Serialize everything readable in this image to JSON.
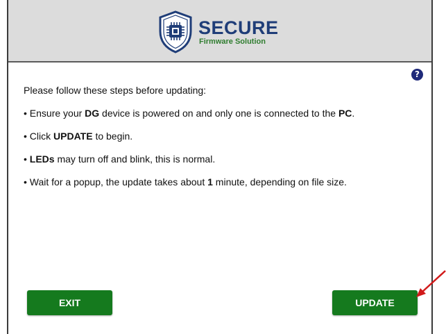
{
  "header": {
    "logo_title": "SECURE",
    "logo_subtitle": "Firmware Solution",
    "logo_icon": "chip-shield-icon"
  },
  "help": {
    "label": "?",
    "icon": "help-icon"
  },
  "instructions": {
    "intro": "Please follow these steps before updating:",
    "steps": [
      {
        "bullet": "•",
        "parts": [
          {
            "t": " Ensure your ",
            "b": false
          },
          {
            "t": "DG",
            "b": true
          },
          {
            "t": " device is powered on and only one is connected to the ",
            "b": false
          },
          {
            "t": "PC",
            "b": true
          },
          {
            "t": ".",
            "b": false
          }
        ]
      },
      {
        "bullet": "•",
        "parts": [
          {
            "t": " Click ",
            "b": false
          },
          {
            "t": "UPDATE",
            "b": true
          },
          {
            "t": " to begin.",
            "b": false
          }
        ]
      },
      {
        "bullet": "•",
        "parts": [
          {
            "t": " ",
            "b": false
          },
          {
            "t": "LEDs",
            "b": true
          },
          {
            "t": " may turn off and blink, this is normal.",
            "b": false
          }
        ]
      },
      {
        "bullet": "•",
        "parts": [
          {
            "t": " Wait for a popup, the update takes about ",
            "b": false
          },
          {
            "t": "1",
            "b": true
          },
          {
            "t": " minute, depending on file size.",
            "b": false
          }
        ]
      }
    ]
  },
  "buttons": {
    "exit_label": "EXIT",
    "update_label": "UPDATE"
  },
  "colors": {
    "header_bg": "#dcdcdc",
    "brand_blue": "#1f3d78",
    "brand_green": "#2f7d2f",
    "button_green": "#157a1e",
    "help_blue": "#1f2a7a",
    "annotation_red": "#d11a1a"
  },
  "annotation": {
    "icon": "red-arrow-pointer-icon"
  }
}
